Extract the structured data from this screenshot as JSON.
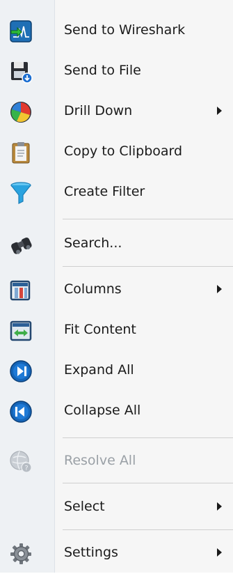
{
  "menu": {
    "items": [
      {
        "label": "Send to Wireshark",
        "icon": "wireshark-icon",
        "submenu": false,
        "disabled": false
      },
      {
        "label": "Send to File",
        "icon": "save-file-icon",
        "submenu": false,
        "disabled": false
      },
      {
        "label": "Drill Down",
        "icon": "pie-chart-icon",
        "submenu": true,
        "disabled": false
      },
      {
        "label": "Copy to Clipboard",
        "icon": "clipboard-icon",
        "submenu": false,
        "disabled": false
      },
      {
        "label": "Create Filter",
        "icon": "funnel-icon",
        "submenu": false,
        "disabled": false
      },
      {
        "label": "Search...",
        "icon": "binoculars-icon",
        "submenu": false,
        "disabled": false
      },
      {
        "label": "Columns",
        "icon": "columns-icon",
        "submenu": true,
        "disabled": false
      },
      {
        "label": "Fit Content",
        "icon": "fit-content-icon",
        "submenu": false,
        "disabled": false
      },
      {
        "label": "Expand All",
        "icon": "expand-all-icon",
        "submenu": false,
        "disabled": false
      },
      {
        "label": "Collapse All",
        "icon": "collapse-all-icon",
        "submenu": false,
        "disabled": false
      },
      {
        "label": "Resolve All",
        "icon": "resolve-icon",
        "submenu": false,
        "disabled": true
      },
      {
        "label": "Select",
        "icon": "",
        "submenu": true,
        "disabled": false
      },
      {
        "label": "Settings",
        "icon": "gear-icon",
        "submenu": true,
        "disabled": false
      }
    ]
  },
  "colors": {
    "gutter": "#eef1f4",
    "menu_background": "#f6f6f6",
    "text": "#1a1a1a",
    "disabled_text": "#9aa0a6",
    "separator": "#cfcfcf"
  }
}
